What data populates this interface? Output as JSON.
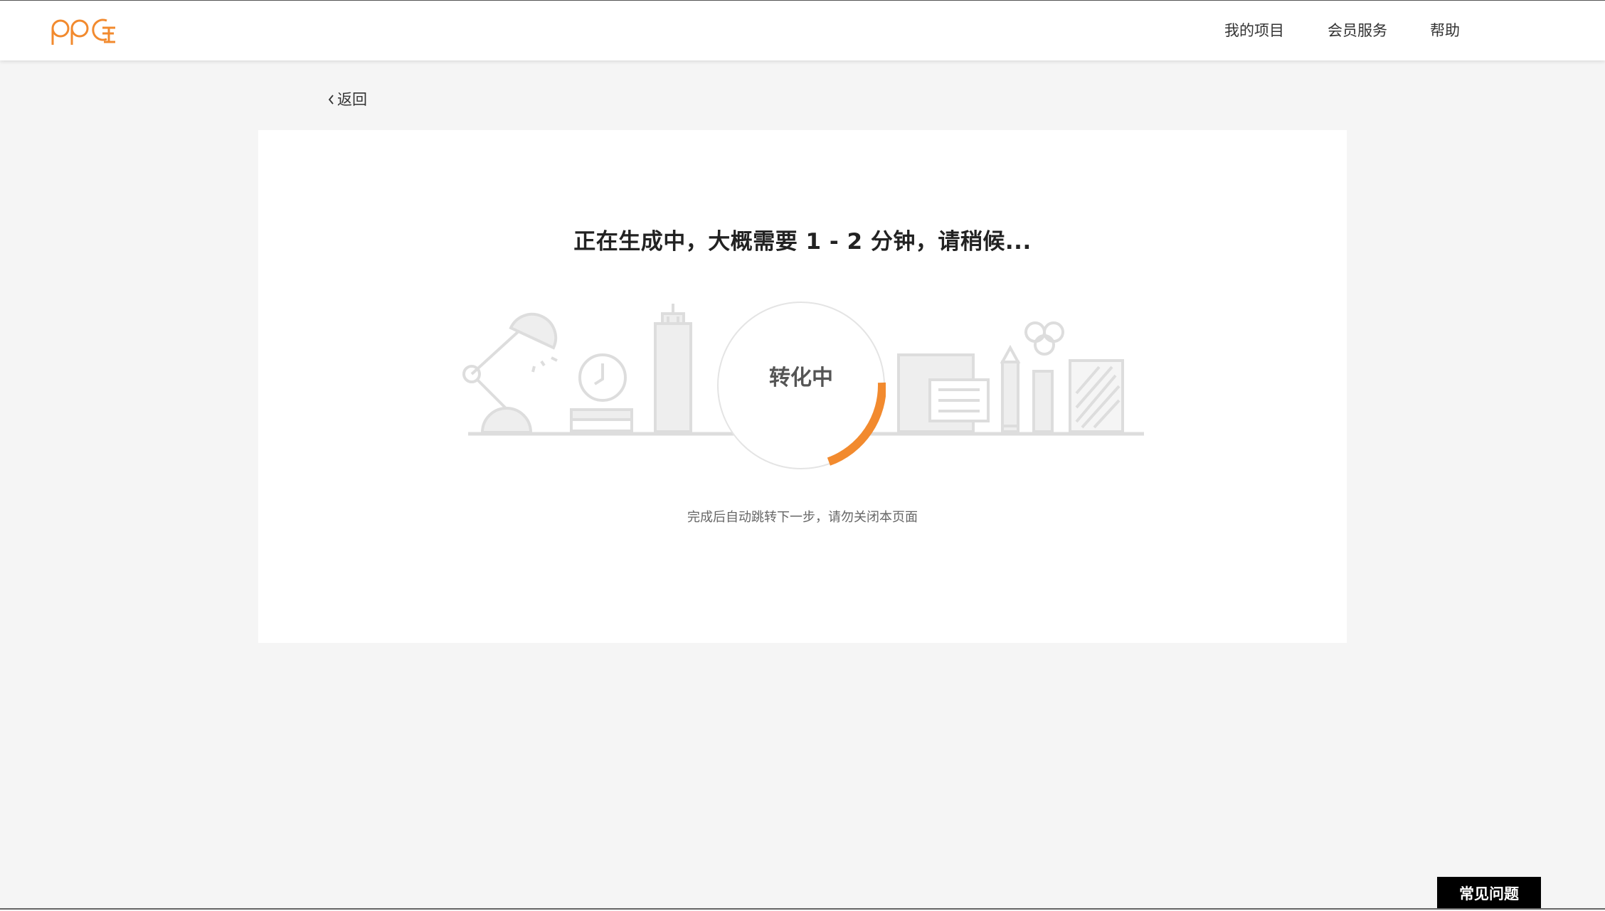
{
  "header": {
    "logo_icon": "ppt-logo-icon",
    "nav": [
      {
        "label": "我的项目"
      },
      {
        "label": "会员服务"
      },
      {
        "label": "帮助"
      }
    ]
  },
  "back": {
    "label": "返回",
    "icon": "chevron-left-icon"
  },
  "main": {
    "headline": "正在生成中，大概需要 1 - 2 分钟，请稍候...",
    "status_label": "转化中",
    "progress_fraction": 0.2,
    "note": "完成后自动跳转下一步，请勿关闭本页面"
  },
  "faq": {
    "label": "常见问题"
  },
  "colors": {
    "accent": "#f28a2e",
    "page_bg": "#f5f5f5",
    "card_bg": "#ffffff",
    "illustration_gray": "#dddddd"
  }
}
